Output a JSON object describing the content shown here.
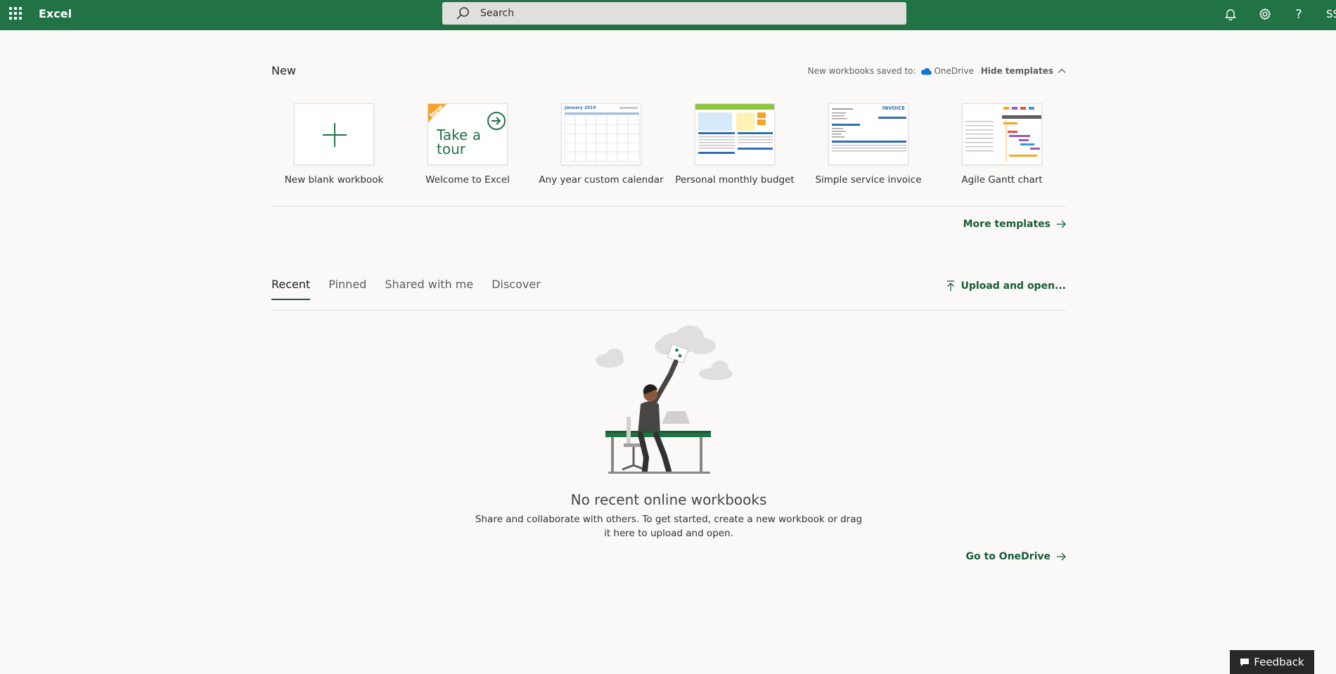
{
  "topbar": {
    "app_name": "Excel",
    "search_placeholder": "Search",
    "user_initials": "SS",
    "icons": [
      "app-launcher-icon",
      "search-icon",
      "bell-icon",
      "gear-icon",
      "help-icon"
    ]
  },
  "new_section": {
    "title": "New",
    "saved_to_label": "New workbooks saved to:",
    "saved_to_location": "OneDrive",
    "hide_templates_label": "Hide templates",
    "templates": [
      {
        "label": "New blank workbook"
      },
      {
        "label": "Welcome to Excel",
        "thumb_badge": "New",
        "thumb_text": "Take a tour"
      },
      {
        "label": "Any year custom calendar",
        "thumb_text": "January 2019"
      },
      {
        "label": "Personal monthly budget"
      },
      {
        "label": "Simple service invoice",
        "thumb_text": "INVOICE"
      },
      {
        "label": "Agile Gantt chart"
      }
    ],
    "more_templates_label": "More templates"
  },
  "files_section": {
    "tabs": [
      {
        "label": "Recent",
        "active": true
      },
      {
        "label": "Pinned",
        "active": false
      },
      {
        "label": "Shared with me",
        "active": false
      },
      {
        "label": "Discover",
        "active": false
      }
    ],
    "upload_label": "Upload and open...",
    "empty_title": "No recent online workbooks",
    "empty_description": "Share and collaborate with others. To get started, create a new workbook or drag it here to upload and open.",
    "go_onedrive_label": "Go to OneDrive"
  },
  "feedback_label": "Feedback",
  "colors": {
    "brand": "#217346",
    "brand_dark": "#185c37",
    "search_bg": "#e1dfdd",
    "page_bg": "#faf9f8"
  }
}
